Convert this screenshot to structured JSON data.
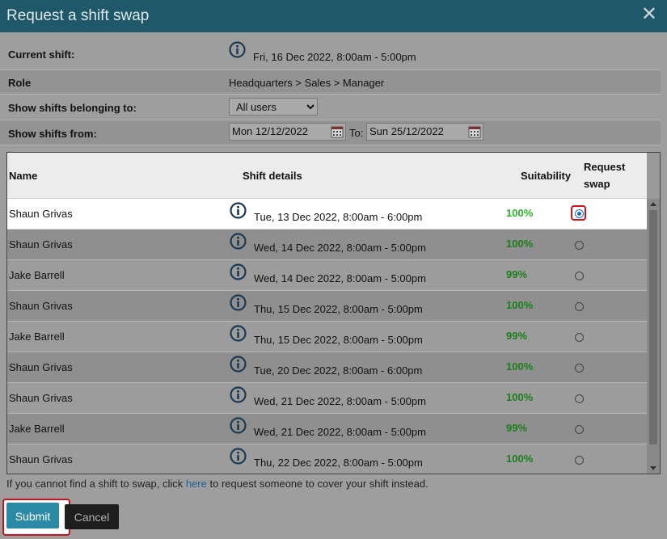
{
  "dialog": {
    "title": "Request a shift swap",
    "close_glyph": "✕"
  },
  "form": {
    "current_shift_label": "Current shift:",
    "current_shift_value": "Fri, 16 Dec 2022, 8:00am - 5:00pm",
    "role_label": "Role",
    "role_value": "Headquarters > Sales > Manager",
    "belonging_label": "Show shifts belonging to:",
    "belonging_selected": "All users",
    "from_label": "Show shifts from:",
    "from_date": "Mon 12/12/2022",
    "to_label": "To:",
    "to_date": "Sun 25/12/2022"
  },
  "table": {
    "headers": {
      "name": "Name",
      "details": "Shift details",
      "suitability": "Suitability",
      "request_swap": "Request swap"
    },
    "rows": [
      {
        "name": "Shaun Grivas",
        "details": "Tue, 13 Dec 2022, 8:00am - 6:00pm",
        "suitability": "100%",
        "selected": true
      },
      {
        "name": "Shaun Grivas",
        "details": "Wed, 14 Dec 2022, 8:00am - 5:00pm",
        "suitability": "100%",
        "selected": false
      },
      {
        "name": "Jake Barrell",
        "details": "Wed, 14 Dec 2022, 8:00am - 5:00pm",
        "suitability": "99%",
        "selected": false
      },
      {
        "name": "Shaun Grivas",
        "details": "Thu, 15 Dec 2022, 8:00am - 5:00pm",
        "suitability": "100%",
        "selected": false
      },
      {
        "name": "Jake Barrell",
        "details": "Thu, 15 Dec 2022, 8:00am - 5:00pm",
        "suitability": "99%",
        "selected": false
      },
      {
        "name": "Shaun Grivas",
        "details": "Tue, 20 Dec 2022, 8:00am - 6:00pm",
        "suitability": "100%",
        "selected": false
      },
      {
        "name": "Shaun Grivas",
        "details": "Wed, 21 Dec 2022, 8:00am - 5:00pm",
        "suitability": "100%",
        "selected": false
      },
      {
        "name": "Jake Barrell",
        "details": "Wed, 21 Dec 2022, 8:00am - 5:00pm",
        "suitability": "99%",
        "selected": false
      },
      {
        "name": "Shaun Grivas",
        "details": "Thu, 22 Dec 2022, 8:00am - 5:00pm",
        "suitability": "100%",
        "selected": false
      }
    ]
  },
  "footer": {
    "note_before": "If you cannot find a shift to swap, click ",
    "note_link": "here",
    "note_after": " to request someone to cover your shift instead.",
    "submit_label": "Submit",
    "cancel_label": "Cancel"
  },
  "colors": {
    "titlebar": "#1f5868",
    "suitability_green": "#1a7f1a",
    "highlight_red": "#d0101b",
    "submit_blue": "#2b8aa6",
    "link": "#1d5e9c"
  },
  "icons": [
    "info-icon",
    "calendar-icon",
    "close-icon"
  ]
}
